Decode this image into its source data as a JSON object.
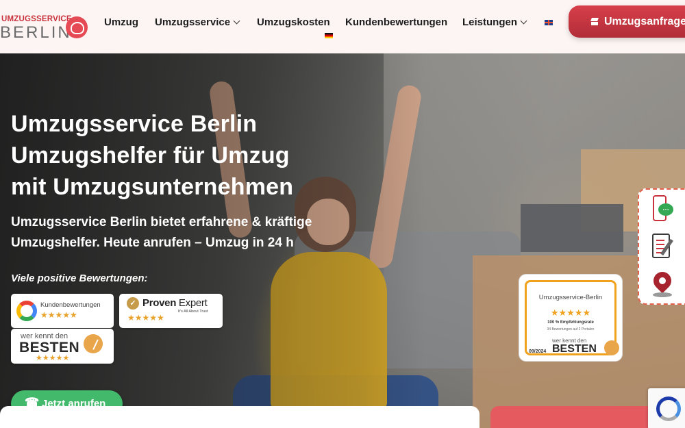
{
  "header": {
    "logo_top": "UMZUGSSERVICE",
    "logo_bottom": "BERLIN",
    "nav": [
      {
        "label": "Umzug"
      },
      {
        "label": "Umzugsservice"
      },
      {
        "label": "Umzugskosten"
      },
      {
        "label": "Kundenbewertungen"
      },
      {
        "label": "Leistungen"
      }
    ],
    "cta_label": "Umzugsanfrage"
  },
  "hero": {
    "title_line1": "Umzugsservice Berlin",
    "title_line2": "Umzugshelfer für Umzug",
    "title_line3": "mit Umzugsunternehmen",
    "subtitle_line1": "Umzugsservice Berlin bietet erfahrene & kräftige",
    "subtitle_line2": "Umzugshelfer. Heute anrufen – Umzug in 24 h",
    "reviews_label": "Viele positive Bewertungen:",
    "call_label": "Jetzt anrufen"
  },
  "badges": {
    "google_label": "Kundenbewertungen",
    "google_stars": "★★★★★",
    "proven_name_bold": "Proven",
    "proven_name_rest": " Expert",
    "proven_tagline": "It's All About Trust",
    "proven_stars": "★★★★★",
    "wkdb_top": "wer kennt den",
    "wkdb_big": "BESTEN",
    "wkdb_stars": "★★★★★"
  },
  "certificate": {
    "title": "Umzugsservice-Berlin",
    "stars": "★★★★★",
    "rate": "100 % Empfehlungsrate",
    "sub": "34 Bewertungen auf 2 Portalen",
    "date": "09/2024",
    "wk_top": "wer kennt den",
    "wk_big": "BESTEN"
  },
  "colors": {
    "brand_red": "#c9313c",
    "call_green": "#43b96b",
    "star_gold": "#e8a22a"
  }
}
